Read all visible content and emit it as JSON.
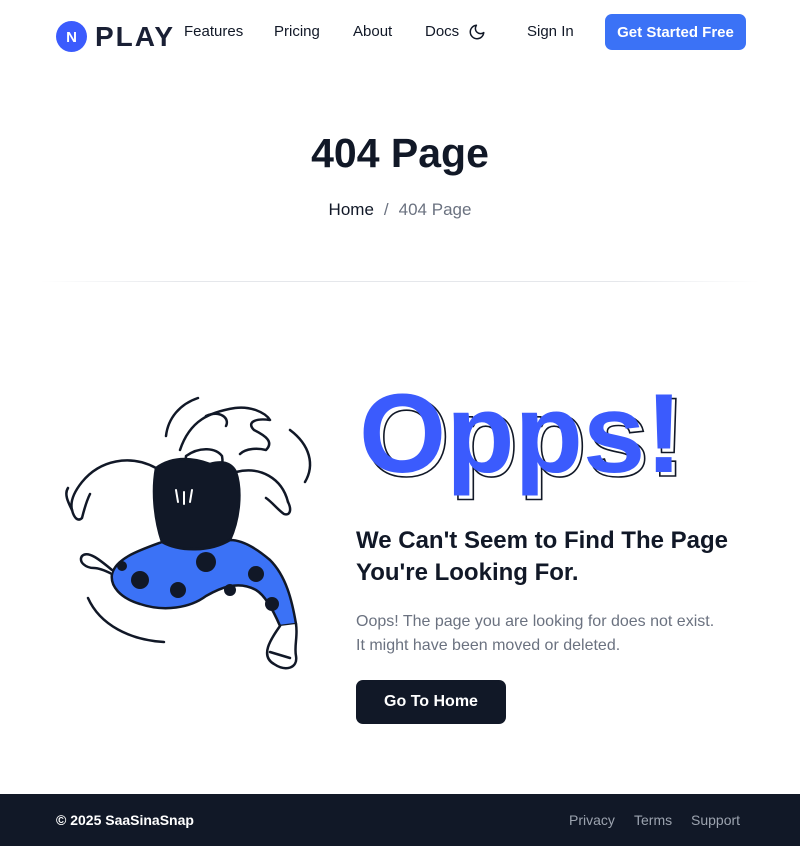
{
  "header": {
    "brand": "PLAY",
    "brand_initial": "N",
    "nav": [
      "Features",
      "Pricing",
      "About",
      "Docs"
    ],
    "theme_icon": "moon-icon",
    "sign_in": "Sign In",
    "cta": "Get Started Free"
  },
  "hero": {
    "title": "404 Page",
    "breadcrumb": {
      "home": "Home",
      "separator": "/",
      "current": "404 Page"
    }
  },
  "error": {
    "big_text": "Opps!",
    "heading_line1": "We Can't Seem to Find The Page",
    "heading_line2": "You're Looking For.",
    "desc_line1": "Oops! The page you are looking for does not exist.",
    "desc_line2": "It might have been moved or deleted.",
    "button": "Go To Home"
  },
  "footer": {
    "copyright": "© 2025 SaaSinaSnap",
    "links": [
      "Privacy",
      "Terms",
      "Support"
    ]
  },
  "colors": {
    "accent": "#3b72f6",
    "brand_mark": "#3b5bfd",
    "dark": "#111827",
    "muted": "#6b7280"
  }
}
